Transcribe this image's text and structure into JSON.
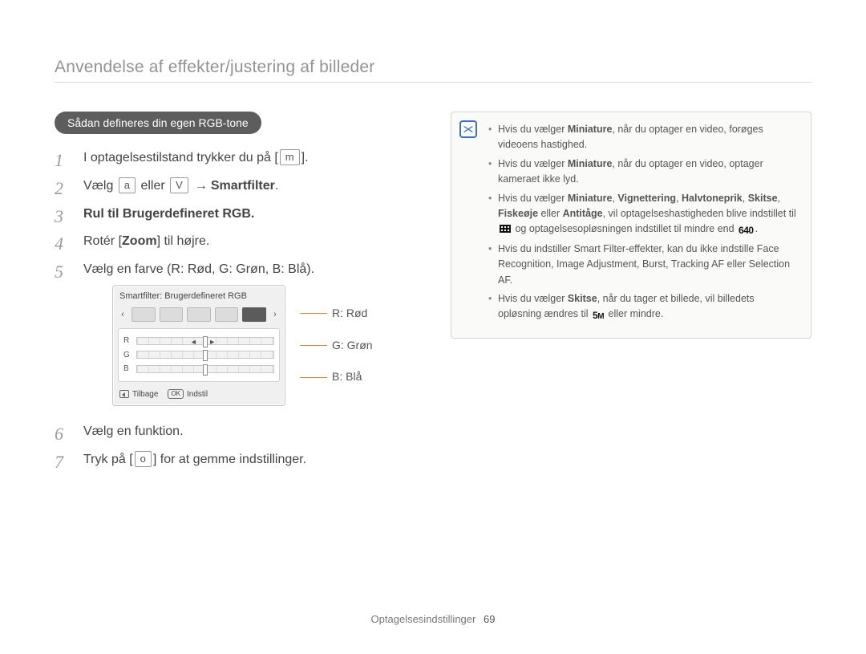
{
  "header": {
    "title": "Anvendelse af effekter/justering af billeder"
  },
  "pill": {
    "title": "Sådan defineres din egen RGB-tone"
  },
  "steps": {
    "s1_a": "I optagelsestilstand trykker du på [",
    "s1_key": "m",
    "s1_b": "].",
    "s2_a": "Vælg ",
    "s2_icon_a": "a",
    "s2_b": " eller ",
    "s2_icon_b": "V",
    "s2_c": "Smartfilter",
    "s2_d": ".",
    "s3": "Rul til Brugerdefineret RGB.",
    "s4_a": "Rotér [",
    "s4_key": "Zoom",
    "s4_b": "] til højre.",
    "s5": "Vælg en farve (R: Rød, G: Grøn, B: Blå).",
    "s6": "Vælg en funktion.",
    "s7_a": "Tryk på [",
    "s7_key": "o",
    "s7_b": "] for at gemme indstillinger."
  },
  "camera": {
    "title": "Smartfilter: Brugerdefineret RGB",
    "back": "Tilbage",
    "ok": "OK",
    "set": "Indstil",
    "channels": {
      "r": "R",
      "g": "G",
      "b": "B"
    }
  },
  "callouts": {
    "r": "R: Rød",
    "g": "G: Grøn",
    "b": "B: Blå"
  },
  "note": {
    "items": [
      {
        "pre": "Hvis du vælger ",
        "b1": "Miniature",
        "post": ", når du optager en video, forøges videoens hastighed."
      },
      {
        "pre": "Hvis du vælger ",
        "b1": "Miniature",
        "post": ", når du optager en video, optager kameraet ikke lyd."
      },
      {
        "pre": "Hvis du vælger ",
        "b1": "Miniature",
        "mid1": ", ",
        "b2": "Vignettering",
        "mid2": ", ",
        "b3": "Halvtoneprik",
        "mid3": ", ",
        "b4": "Skitse",
        "mid4": ", ",
        "b5": "Fiskeøje",
        "mid5": " eller ",
        "b6": "Antitåge",
        "post": ", vil optagelseshastigheden blive indstillet til ",
        "glyph1": "frame",
        "post2": " og optagelsesopløsningen indstillet til mindre end ",
        "glyph2": "640",
        "post3": "."
      },
      {
        "pre": "Hvis du indstiller Smart Filter-effekter, kan du ikke indstille Face Recognition, Image Adjustment, Burst, Tracking AF eller Selection AF."
      },
      {
        "pre": "Hvis du vælger ",
        "b1": "Skitse",
        "post": ", når du tager et billede, vil billedets opløsning ændres til ",
        "glyph1": "5m",
        "post2": " eller mindre."
      }
    ]
  },
  "footer": {
    "section": "Optagelsesindstillinger",
    "page": "69"
  }
}
